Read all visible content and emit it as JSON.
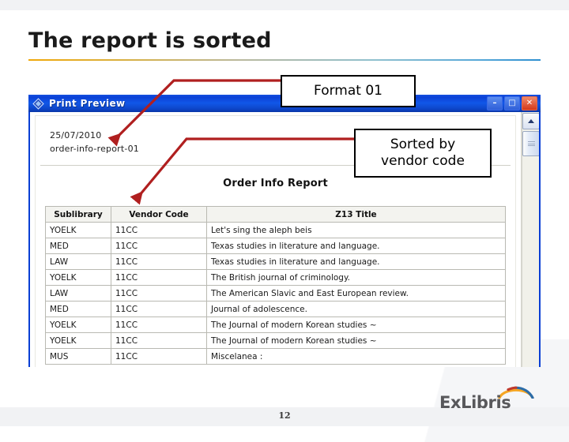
{
  "slide": {
    "title": "The report is sorted",
    "page_number": "12",
    "logo_text": "ExLibris",
    "accent_red": "#b01f1f",
    "title_rule_colors": [
      "#f0a80a",
      "#2e8fd0"
    ]
  },
  "window": {
    "title": "Print Preview",
    "icon": "diamond-app-icon",
    "controls": {
      "minimize": "–",
      "maximize": "□",
      "close": "✕"
    }
  },
  "document": {
    "date": "25/07/2010",
    "report_id": "order-info-report-01",
    "report_title": "Order Info Report",
    "columns": [
      "Sublibrary",
      "Vendor Code",
      "Z13 Title"
    ],
    "rows": [
      [
        "YOELK",
        "11CC",
        "Let's sing the aleph beis"
      ],
      [
        "MED",
        "11CC",
        "Texas studies in literature and language."
      ],
      [
        "LAW",
        "11CC",
        "Texas studies in literature and language."
      ],
      [
        "YOELK",
        "11CC",
        "The British journal of criminology."
      ],
      [
        "LAW",
        "11CC",
        "The American Slavic and East European review."
      ],
      [
        "MED",
        "11CC",
        "Journal of adolescence."
      ],
      [
        "YOELK",
        "11CC",
        "The Journal of modern Korean studies ~"
      ],
      [
        "YOELK",
        "11CC",
        "The Journal of modern Korean studies ~"
      ],
      [
        "MUS",
        "11CC",
        "Miscelanea :"
      ]
    ]
  },
  "callouts": {
    "format": "Format 01",
    "sorted_line1": "Sorted by",
    "sorted_line2": "vendor code"
  },
  "scrollbar": {
    "up_arrow": "scroll-up-arrow"
  }
}
